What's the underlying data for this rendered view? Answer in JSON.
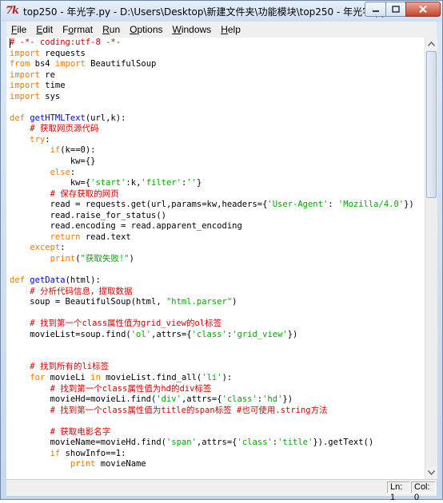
{
  "window": {
    "title": "top250 - 年光字.py - D:\\Users\\Desktop\\新建文件夹\\功能模块\\top250 - 年光字.py",
    "app_icon": "7k"
  },
  "menu": [
    {
      "label": "File",
      "accel": "F",
      "rest": "ile"
    },
    {
      "label": "Edit",
      "accel": "E",
      "rest": "dit"
    },
    {
      "label": "Format",
      "accel": "o",
      "pre": "F",
      "rest": "rmat"
    },
    {
      "label": "Run",
      "accel": "R",
      "rest": "un"
    },
    {
      "label": "Options",
      "accel": "O",
      "rest": "ptions"
    },
    {
      "label": "Windows",
      "accel": "W",
      "rest": "indows"
    },
    {
      "label": "Help",
      "accel": "H",
      "rest": "elp"
    }
  ],
  "code_lines": [
    [
      [
        "c",
        "# -*- coding:utf-8 -*-"
      ]
    ],
    [
      [
        "k",
        "import"
      ],
      [
        "n",
        " requests"
      ]
    ],
    [
      [
        "k",
        "from"
      ],
      [
        "n",
        " bs4 "
      ],
      [
        "k",
        "import"
      ],
      [
        "n",
        " BeautifulSoup"
      ]
    ],
    [
      [
        "k",
        "import"
      ],
      [
        "n",
        " re"
      ]
    ],
    [
      [
        "k",
        "import"
      ],
      [
        "n",
        " time"
      ]
    ],
    [
      [
        "k",
        "import"
      ],
      [
        "n",
        " sys"
      ]
    ],
    [],
    [
      [
        "k",
        "def"
      ],
      [
        "n",
        " "
      ],
      [
        "d",
        "getHTMLText"
      ],
      [
        "n",
        "(url,k):"
      ]
    ],
    [
      [
        "n",
        "    "
      ],
      [
        "c",
        "# 获取网页源代码"
      ]
    ],
    [
      [
        "n",
        "    "
      ],
      [
        "k",
        "try"
      ],
      [
        "n",
        ":"
      ]
    ],
    [
      [
        "n",
        "        "
      ],
      [
        "k",
        "if"
      ],
      [
        "n",
        "(k==0):"
      ]
    ],
    [
      [
        "n",
        "            kw={}"
      ]
    ],
    [
      [
        "n",
        "        "
      ],
      [
        "k",
        "else"
      ],
      [
        "n",
        ":"
      ]
    ],
    [
      [
        "n",
        "            kw={"
      ],
      [
        "s",
        "'start'"
      ],
      [
        "n",
        ":k,"
      ],
      [
        "s",
        "'filter'"
      ],
      [
        "n",
        ":"
      ],
      [
        "s",
        "''"
      ],
      [
        "n",
        "}"
      ]
    ],
    [
      [
        "n",
        "        "
      ],
      [
        "c",
        "# 保存获取的网页"
      ]
    ],
    [
      [
        "n",
        "        read = requests.get(url,params=kw,headers={"
      ],
      [
        "s",
        "'User-Agent'"
      ],
      [
        "n",
        ": "
      ],
      [
        "s",
        "'Mozilla/4.0'"
      ],
      [
        "n",
        "})"
      ]
    ],
    [
      [
        "n",
        "        read.raise_for_status()"
      ]
    ],
    [
      [
        "n",
        "        read.encoding = read.apparent_encoding"
      ]
    ],
    [
      [
        "n",
        "        "
      ],
      [
        "k",
        "return"
      ],
      [
        "n",
        " read.text"
      ]
    ],
    [
      [
        "n",
        "    "
      ],
      [
        "k",
        "except"
      ],
      [
        "n",
        ":"
      ]
    ],
    [
      [
        "n",
        "        "
      ],
      [
        "k",
        "print"
      ],
      [
        "n",
        "("
      ],
      [
        "s",
        "\"获取失败!\""
      ],
      [
        "n",
        ")"
      ]
    ],
    [],
    [
      [
        "k",
        "def"
      ],
      [
        "n",
        " "
      ],
      [
        "d",
        "getData"
      ],
      [
        "n",
        "(html):"
      ]
    ],
    [
      [
        "n",
        "    "
      ],
      [
        "c",
        "# 分析代码信息，提取数据"
      ]
    ],
    [
      [
        "n",
        "    soup = BeautifulSoup(html, "
      ],
      [
        "s",
        "\"html.parser\""
      ],
      [
        "n",
        ")"
      ]
    ],
    [],
    [
      [
        "n",
        "    "
      ],
      [
        "c",
        "# 找到第一个class属性值为grid_view的ol标签"
      ]
    ],
    [
      [
        "n",
        "    movieList=soup.find("
      ],
      [
        "s",
        "'ol'"
      ],
      [
        "n",
        ",attrs={"
      ],
      [
        "s",
        "'class'"
      ],
      [
        "n",
        ":"
      ],
      [
        "s",
        "'grid_view'"
      ],
      [
        "n",
        "})"
      ]
    ],
    [],
    [],
    [
      [
        "n",
        "    "
      ],
      [
        "c",
        "# 找到所有的li标签"
      ]
    ],
    [
      [
        "n",
        "    "
      ],
      [
        "k",
        "for"
      ],
      [
        "n",
        " movieLi "
      ],
      [
        "k",
        "in"
      ],
      [
        "n",
        " movieList.find_all("
      ],
      [
        "s",
        "'li'"
      ],
      [
        "n",
        "):"
      ]
    ],
    [
      [
        "n",
        "        "
      ],
      [
        "c",
        "# 找到第一个class属性值为hd的div标签"
      ]
    ],
    [
      [
        "n",
        "        movieHd=movieLi.find("
      ],
      [
        "s",
        "'div'"
      ],
      [
        "n",
        ",attrs={"
      ],
      [
        "s",
        "'class'"
      ],
      [
        "n",
        ":"
      ],
      [
        "s",
        "'hd'"
      ],
      [
        "n",
        "})"
      ]
    ],
    [
      [
        "n",
        "        "
      ],
      [
        "c",
        "# 找到第一个class属性值为title的span标签 #也可使用.string方法"
      ]
    ],
    [],
    [
      [
        "n",
        "        "
      ],
      [
        "c",
        "# 获取电影名字"
      ]
    ],
    [
      [
        "n",
        "        movieName=movieHd.find("
      ],
      [
        "s",
        "'span'"
      ],
      [
        "n",
        ",attrs={"
      ],
      [
        "s",
        "'class'"
      ],
      [
        "n",
        ":"
      ],
      [
        "s",
        "'title'"
      ],
      [
        "n",
        "}).getText()"
      ]
    ],
    [
      [
        "n",
        "        "
      ],
      [
        "k",
        "if"
      ],
      [
        "n",
        " showInfo==1:"
      ]
    ],
    [
      [
        "n",
        "            "
      ],
      [
        "k",
        "print"
      ],
      [
        "n",
        " movieName"
      ]
    ]
  ],
  "status": {
    "line": "Ln: 1",
    "col": "Col: 0"
  },
  "colors": {
    "comment": "#dd0000",
    "keyword": "#ff7700",
    "def_name": "#0000ff",
    "string": "#00aa00"
  }
}
